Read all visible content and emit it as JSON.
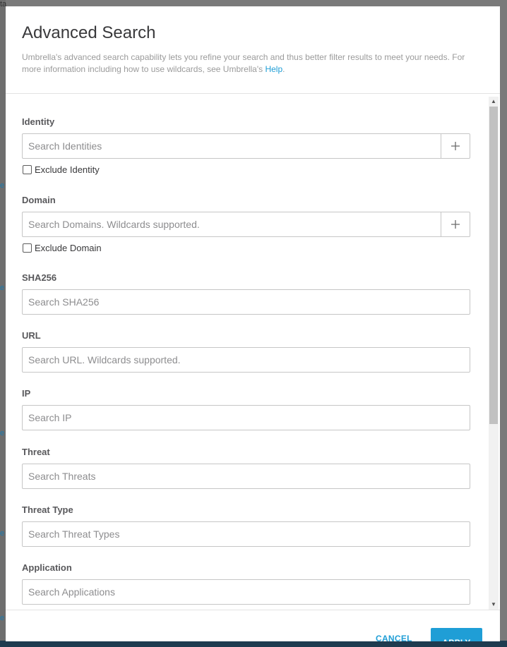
{
  "backdrop": {
    "fragments": [
      "ta",
      "e",
      "e",
      "e",
      "e",
      "e",
      "e"
    ]
  },
  "modal": {
    "title": "Advanced Search",
    "description": "Umbrella's advanced search capability lets you refine your search and thus better filter results to meet your needs. For more information including how to use wildcards, see Umbrella's ",
    "help_link": "Help",
    "help_suffix": "."
  },
  "fields": {
    "identity": {
      "label": "Identity",
      "placeholder": "Search Identities",
      "add": "+",
      "exclude_label": "Exclude Identity",
      "exclude_checked": false
    },
    "domain": {
      "label": "Domain",
      "placeholder": "Search Domains. Wildcards supported.",
      "add": "+",
      "exclude_label": "Exclude Domain",
      "exclude_checked": false
    },
    "sha256": {
      "label": "SHA256",
      "placeholder": "Search SHA256"
    },
    "url": {
      "label": "URL",
      "placeholder": "Search URL. Wildcards supported."
    },
    "ip": {
      "label": "IP",
      "placeholder": "Search IP"
    },
    "threat": {
      "label": "Threat",
      "placeholder": "Search Threats"
    },
    "threat_type": {
      "label": "Threat Type",
      "placeholder": "Search Threat Types"
    },
    "application": {
      "label": "Application",
      "placeholder": "Search Applications"
    }
  },
  "scrollbar": {
    "up": "▲",
    "down": "▼",
    "position": 0
  },
  "footer": {
    "cancel_label": "CANCEL",
    "apply_label": "APPLY"
  },
  "colors": {
    "accent": "#1f9ed6",
    "title": "#39393b",
    "overlay": "#7a7a7a",
    "bottom_bar": "#1e3b4f"
  },
  "icons": {
    "add": "plus-icon",
    "up": "scroll-up-arrow-icon",
    "down": "scroll-down-arrow-icon"
  }
}
